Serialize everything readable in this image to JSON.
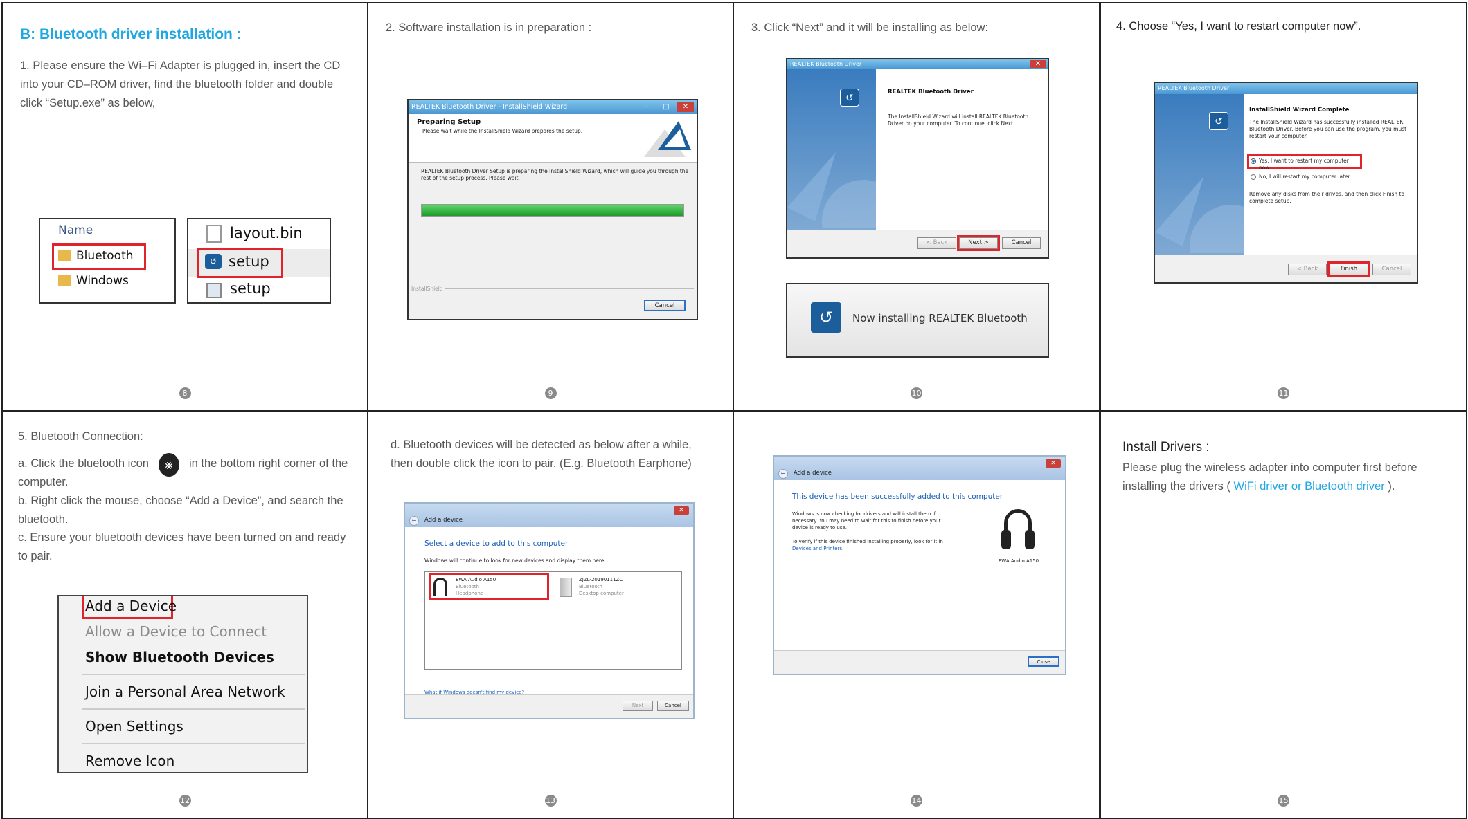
{
  "p8": {
    "title": "B: Bluetooth driver installation :",
    "text": "1. Please ensure the Wi–Fi Adapter is plugged in, insert the CD into your CD–ROM driver, find the bluetooth folder and double click “Setup.exe” as below,",
    "name_header": "Name",
    "folder1": "Bluetooth",
    "folder2": "Windows",
    "file1": "layout.bin",
    "file2": "setup",
    "file3": "setup",
    "num": "8"
  },
  "p9": {
    "text": "2. Software installation is in preparation :",
    "win_title": "REALTEK Bluetooth Driver - InstallShield Wizard",
    "heading": "Preparing Setup",
    "sub": "Please wait while the InstallShield Wizard prepares the setup.",
    "body": "REALTEK Bluetooth Driver Setup is preparing the InstallShield Wizard, which will guide you through the rest of the setup process. Please wait.",
    "progress": 1.0,
    "brand": "InstallShield",
    "cancel": "Cancel",
    "num": "9"
  },
  "p10": {
    "text": "3. Click “Next” and it will be installing as below:",
    "win_title": "REALTEK Bluetooth Driver",
    "heading": "REALTEK Bluetooth Driver",
    "body": "The InstallShield Wizard will install REALTEK Bluetooth Driver on your computer. To continue, click Next.",
    "back": "< Back",
    "next": "Next >",
    "cancel": "Cancel",
    "installing": "Now installing REALTEK Bluetooth",
    "num": "10"
  },
  "p11": {
    "text": "4. Choose “Yes, I want to restart computer now”.",
    "win_title": "REALTEK Bluetooth Driver",
    "heading": "InstallShield Wizard Complete",
    "body": "The InstallShield Wizard has successfully installed REALTEK Bluetooth Driver. Before you can use the program, you must restart your computer.",
    "opt1": "Yes, I want to restart my computer now.",
    "opt2": "No, I will restart my computer later.",
    "note": "Remove any disks from their drives, and then click Finish to complete setup.",
    "back": "< Back",
    "finish": "Finish",
    "cancel": "Cancel",
    "num": "11"
  },
  "p12": {
    "title": "5. Bluetooth Connection:",
    "a1": "a. Click the bluetooth icon",
    "a2": "in the bottom right corner of the computer.",
    "b": "b. Right click the mouse, choose “Add a Device”, and search the bluetooth.",
    "c": "c. Ensure your bluetooth devices have been turned on and ready to pair.",
    "menu": [
      "Add a Device",
      "Allow a Device to Connect",
      "Show Bluetooth Devices",
      "Join a Personal Area Network",
      "Open Settings",
      "Remove Icon"
    ],
    "num": "12"
  },
  "p13": {
    "text": "d. Bluetooth devices will be detected as below after a while, then double click the icon to pair. (E.g. Bluetooth Earphone)",
    "win_title": "Add a device",
    "heading": "Select a device to add to this computer",
    "sub": "Windows will continue to look for new devices and display them here.",
    "dev1": {
      "name": "EWA Audio A150",
      "type": "Bluetooth",
      "kind": "Headphone"
    },
    "dev2": {
      "name": "ZJZL-20190111ZC",
      "type": "Bluetooth",
      "kind": "Desktop computer"
    },
    "link": "What if Windows doesn't find my device?",
    "next": "Next",
    "cancel": "Cancel",
    "num": "13"
  },
  "p14": {
    "win_title": "Add a device",
    "heading": "This device has been successfully added to this computer",
    "body1": "Windows is now checking for drivers and will install them if necessary. You may need to wait for this to finish before your device is ready to use.",
    "body2": "To verify if this device finished installing properly, look for it in",
    "link": "Devices and Printers",
    "device": "EWA Audio A150",
    "close": "Close",
    "num": "14"
  },
  "p15": {
    "title": "Install Drivers :",
    "text1": "Please plug the wireless adapter into computer first before installing the drivers (",
    "link": "WiFi driver or Bluetooth driver",
    "text2": ").",
    "num": "15"
  }
}
